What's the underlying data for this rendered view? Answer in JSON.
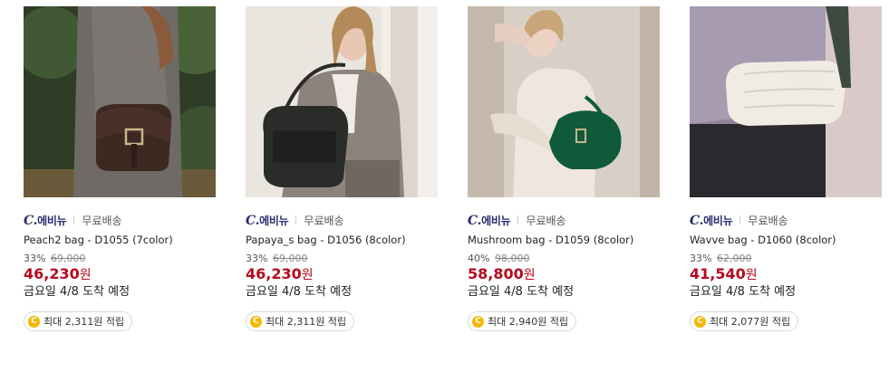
{
  "products": [
    {
      "brand_prefix": "C.",
      "brand_name": "에비뉴",
      "shipping": "무료배송",
      "name": "Peach2 bag - D1055 (7color)",
      "discount": "33%",
      "original_price": "69,000",
      "price": "46,230",
      "currency": "원",
      "arrival": "금요일 4/8 도착 예정",
      "reward_coin": "C",
      "reward": "최대 2,311원 적립"
    },
    {
      "brand_prefix": "C.",
      "brand_name": "에비뉴",
      "shipping": "무료배송",
      "name": "Papaya_s bag - D1056 (8color)",
      "discount": "33%",
      "original_price": "69,000",
      "price": "46,230",
      "currency": "원",
      "arrival": "금요일 4/8 도착 예정",
      "reward_coin": "C",
      "reward": "최대 2,311원 적립"
    },
    {
      "brand_prefix": "C.",
      "brand_name": "에비뉴",
      "shipping": "무료배송",
      "name": "Mushroom bag - D1059 (8color)",
      "discount": "40%",
      "original_price": "98,000",
      "price": "58,800",
      "currency": "원",
      "arrival": "금요일 4/8 도착 예정",
      "reward_coin": "C",
      "reward": "최대 2,940원 적립"
    },
    {
      "brand_prefix": "C.",
      "brand_name": "에비뉴",
      "shipping": "무료배송",
      "name": "Wavve bag - D1060 (8color)",
      "discount": "33%",
      "original_price": "62,000",
      "price": "41,540",
      "currency": "원",
      "arrival": "금요일 4/8 도착 예정",
      "reward_coin": "C",
      "reward": "최대 2,077원 적립"
    }
  ],
  "colors": {
    "price": "#b5091d",
    "brand": "#2a2a6e",
    "coin": "#f5b800"
  }
}
